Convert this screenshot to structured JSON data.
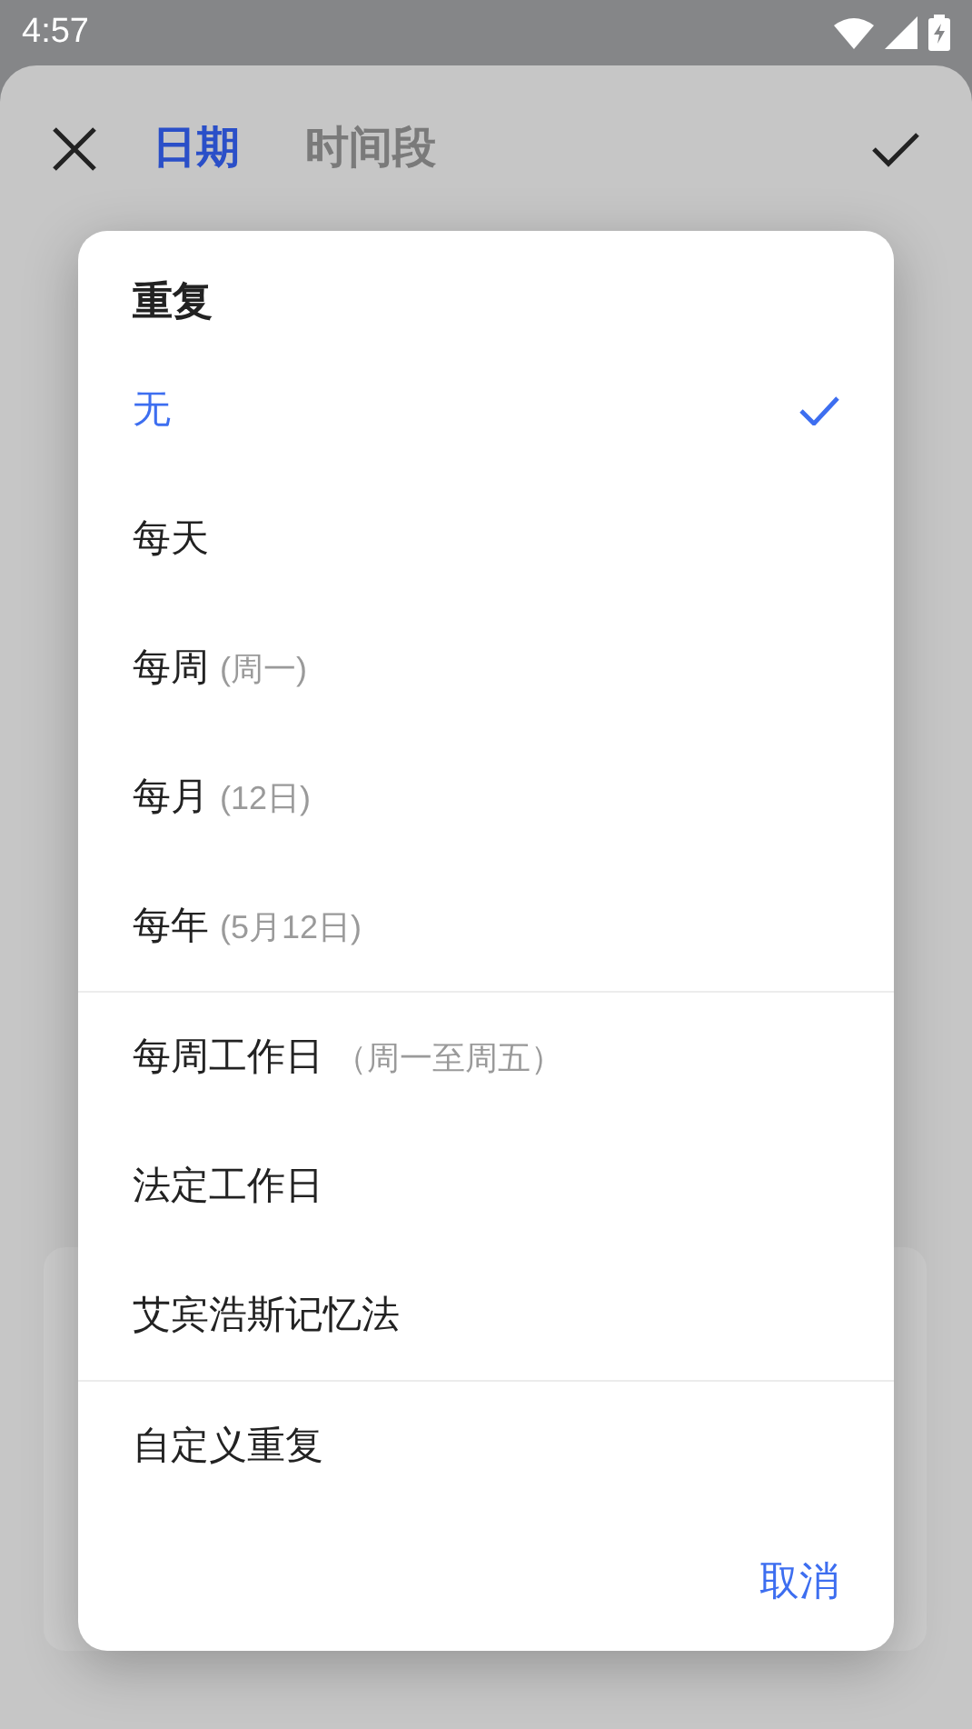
{
  "status_bar": {
    "time": "4:57"
  },
  "header": {
    "tabs": [
      {
        "label": "日期",
        "selected": true
      },
      {
        "label": "时间段",
        "selected": false
      }
    ]
  },
  "dialog": {
    "title": "重复",
    "groups": [
      [
        {
          "label": "无",
          "selected": true
        },
        {
          "label": "每天",
          "selected": false
        },
        {
          "label": "每周",
          "hint": "(周一)",
          "selected": false
        },
        {
          "label": "每月",
          "hint": "(12日)",
          "selected": false
        },
        {
          "label": "每年",
          "hint": "(5月12日)",
          "selected": false
        }
      ],
      [
        {
          "label": "每周工作日",
          "hint": "（周一至周五）",
          "selected": false
        },
        {
          "label": "法定工作日",
          "selected": false
        },
        {
          "label": "艾宾浩斯记忆法",
          "selected": false
        }
      ],
      [
        {
          "label": "自定义重复",
          "selected": false
        }
      ]
    ],
    "cancel": "取消"
  }
}
